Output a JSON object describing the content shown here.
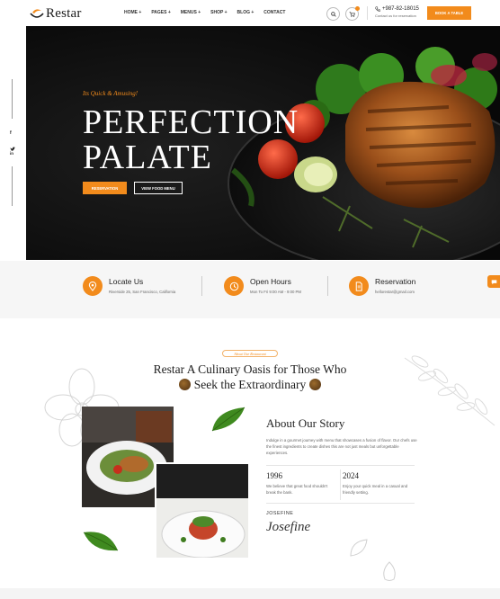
{
  "brand": {
    "name": "Restar"
  },
  "nav": [
    {
      "label": "HOME +"
    },
    {
      "label": "PAGES +"
    },
    {
      "label": "MENUS +"
    },
    {
      "label": "SHOP +"
    },
    {
      "label": "BLOG +"
    },
    {
      "label": "CONTACT"
    }
  ],
  "header": {
    "phone": "+987-82-18015",
    "phone_sub": "Contact us for reservation",
    "book_label": "BOOK A TABLE"
  },
  "hero": {
    "tagline": "Its Quick & Amusing!",
    "title_line1": "PERFECTION",
    "title_line2": "PALATE",
    "reservation_label": "RESERVATION",
    "menu_label": "VIEW FOOD MENU",
    "social": [
      "f",
      "t",
      "in"
    ]
  },
  "info": [
    {
      "title": "Locate Us",
      "sub": "Riverside 25, San Francisco, California",
      "icon": "location-pin-icon"
    },
    {
      "title": "Open Hours",
      "sub": "Mon To Fri 9:00 AM - 9:00 PM",
      "icon": "clock-icon"
    },
    {
      "title": "Reservation",
      "sub": "hellorestar@gmail.com",
      "icon": "document-icon"
    }
  ],
  "about": {
    "subtitle": "About Our Restaurant",
    "heading_line1": "Restar A Culinary Oasis for Those Who",
    "heading_line2": "Seek the Extraordinary",
    "title": "About Our Story",
    "text": "Indulge in a gourmet journey with menu that showcases a fusion of flavor. Our chefs use the finest ingredients to create dishes this are not just meals but unforgettable experiences.",
    "stats": [
      {
        "year": "1996",
        "text": "We believe that great food shouldn't break the bank."
      },
      {
        "year": "2024",
        "text": "Enjoy your quick meal in a casual and friendly setting."
      }
    ],
    "signer": "JOSEFINE",
    "signature": "Josefine"
  },
  "colors": {
    "accent": "#f28b1c",
    "hero_bg": "#141414"
  }
}
